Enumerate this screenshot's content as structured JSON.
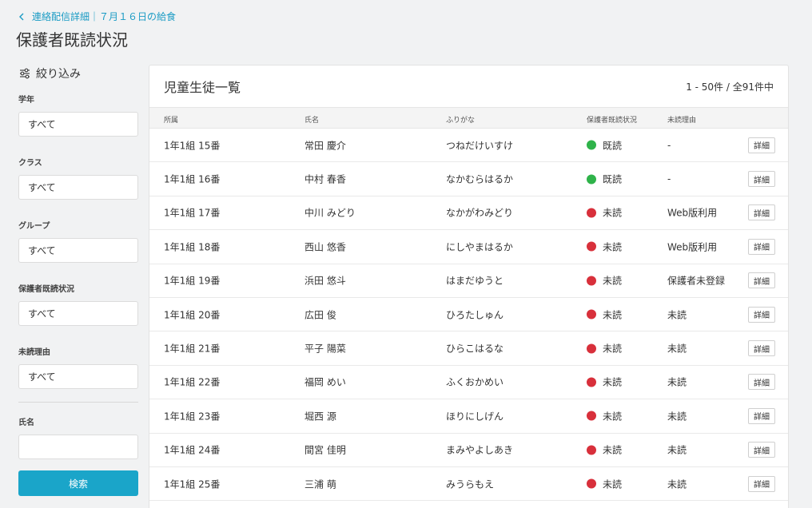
{
  "breadcrumb": {
    "label": "連絡配信詳細｜７月１６日の給食"
  },
  "page_title": "保護者既読状況",
  "filter": {
    "title": "絞り込み",
    "fields": [
      {
        "label": "学年",
        "value": "すべて"
      },
      {
        "label": "クラス",
        "value": "すべて"
      },
      {
        "label": "グループ",
        "value": "すべて"
      },
      {
        "label": "保護者既読状況",
        "value": "すべて"
      },
      {
        "label": "未読理由",
        "value": "すべて"
      }
    ],
    "name_label": "氏名",
    "name_value": "",
    "search_label": "検索"
  },
  "list": {
    "title": "児童生徒一覧",
    "count": "1 - 50件 / 全91件中",
    "columns": [
      "所属",
      "氏名",
      "ふりがな",
      "保護者既読状況",
      "未読理由"
    ],
    "detail_label": "詳細",
    "rows": [
      {
        "class": "1年1組 15番",
        "name": "常田 慶介",
        "kana": "つねだけいすけ",
        "status": "既読",
        "reason": "-"
      },
      {
        "class": "1年1組 16番",
        "name": "中村 春香",
        "kana": "なかむらはるか",
        "status": "既読",
        "reason": "-"
      },
      {
        "class": "1年1組 17番",
        "name": "中川 みどり",
        "kana": "なかがわみどり",
        "status": "未読",
        "reason": "Web版利用"
      },
      {
        "class": "1年1組 18番",
        "name": "西山 悠香",
        "kana": "にしやまはるか",
        "status": "未読",
        "reason": "Web版利用"
      },
      {
        "class": "1年1組 19番",
        "name": "浜田 悠斗",
        "kana": "はまだゆうと",
        "status": "未読",
        "reason": "保護者未登録"
      },
      {
        "class": "1年1組 20番",
        "name": "広田 俊",
        "kana": "ひろたしゅん",
        "status": "未読",
        "reason": "未読"
      },
      {
        "class": "1年1組 21番",
        "name": "平子 陽菜",
        "kana": "ひらこはるな",
        "status": "未読",
        "reason": "未読"
      },
      {
        "class": "1年1組 22番",
        "name": "福岡 めい",
        "kana": "ふくおかめい",
        "status": "未読",
        "reason": "未読"
      },
      {
        "class": "1年1組 23番",
        "name": "堀西 源",
        "kana": "ほりにしげん",
        "status": "未読",
        "reason": "未読"
      },
      {
        "class": "1年1組 24番",
        "name": "間宮 佳明",
        "kana": "まみやよしあき",
        "status": "未読",
        "reason": "未読"
      },
      {
        "class": "1年1組 25番",
        "name": "三浦 萌",
        "kana": "みうらもえ",
        "status": "未読",
        "reason": "未読"
      }
    ]
  },
  "colors": {
    "accent": "#1aa5c9",
    "read": "#2fb34a",
    "unread": "#d8303b"
  },
  "icons": {
    "breadcrumb": "chevron-left-icon",
    "filter": "sliders-icon",
    "status": "status-dot-icon"
  }
}
